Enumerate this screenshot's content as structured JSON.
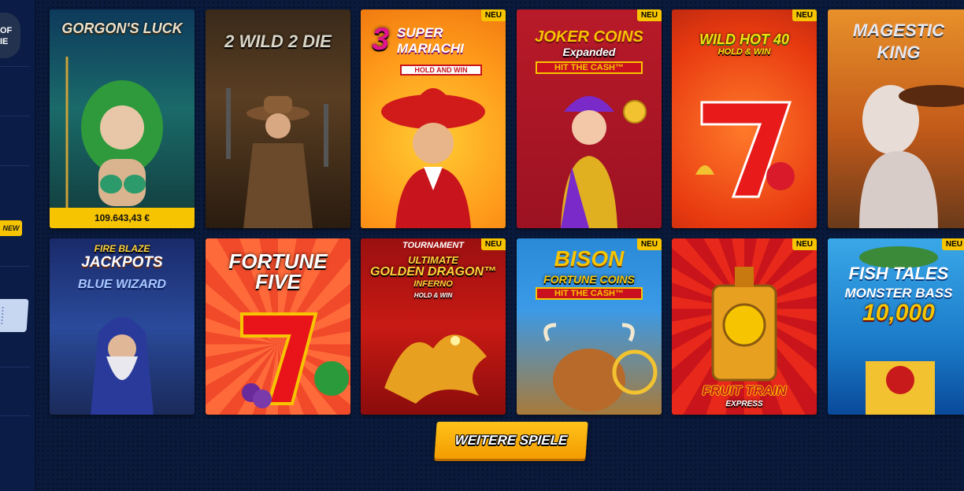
{
  "sidebar": {
    "logo_text_line1": "OF",
    "logo_text_line2": "IE",
    "new_badge": "NEW"
  },
  "games": [
    {
      "title": "GORGON'S LUCK",
      "jackpot": "109.643,43 €"
    },
    {
      "title": "2 WILD 2 DIE"
    },
    {
      "title_num": "3",
      "title": "SUPER MARIACHI",
      "subtitle": "HOLD AND WIN",
      "badge": "NEU"
    },
    {
      "title": "JOKER COINS",
      "title2": "Expanded",
      "subtitle": "HIT THE CASH™",
      "badge": "NEU"
    },
    {
      "title": "WILD HOT 40",
      "subtitle": "HOLD & WIN",
      "badge": "NEU"
    },
    {
      "title": "MAGESTIC",
      "title2": "KING"
    },
    {
      "title": "FIRE BLAZE",
      "title2": "JACKPOTS",
      "subtitle": "BLUE WIZARD"
    },
    {
      "title": "FORTUNE",
      "title2": "FIVE"
    },
    {
      "topline": "TOURNAMENT",
      "title": "ULTIMATE",
      "title2": "GOLDEN DRAGON™",
      "title3": "INFERNO",
      "subtitle": "HOLD & WIN",
      "badge": "NEU"
    },
    {
      "title": "BISON",
      "title2": "FORTUNE COINS",
      "subtitle": "HIT THE CASH™",
      "badge": "NEU"
    },
    {
      "title": "FRUIT TRAIN",
      "title2": "EXPRESS",
      "badge": "NEU"
    },
    {
      "title": "FISH TALES",
      "title2": "MONSTER BASS",
      "title3": "10,000",
      "badge": "NEU"
    }
  ],
  "more_button": "WEITERE SPIELE",
  "colors": {
    "page_bg": "#0a1a3c",
    "accent_yellow": "#f6c400",
    "button_orange": "#f39c00"
  }
}
